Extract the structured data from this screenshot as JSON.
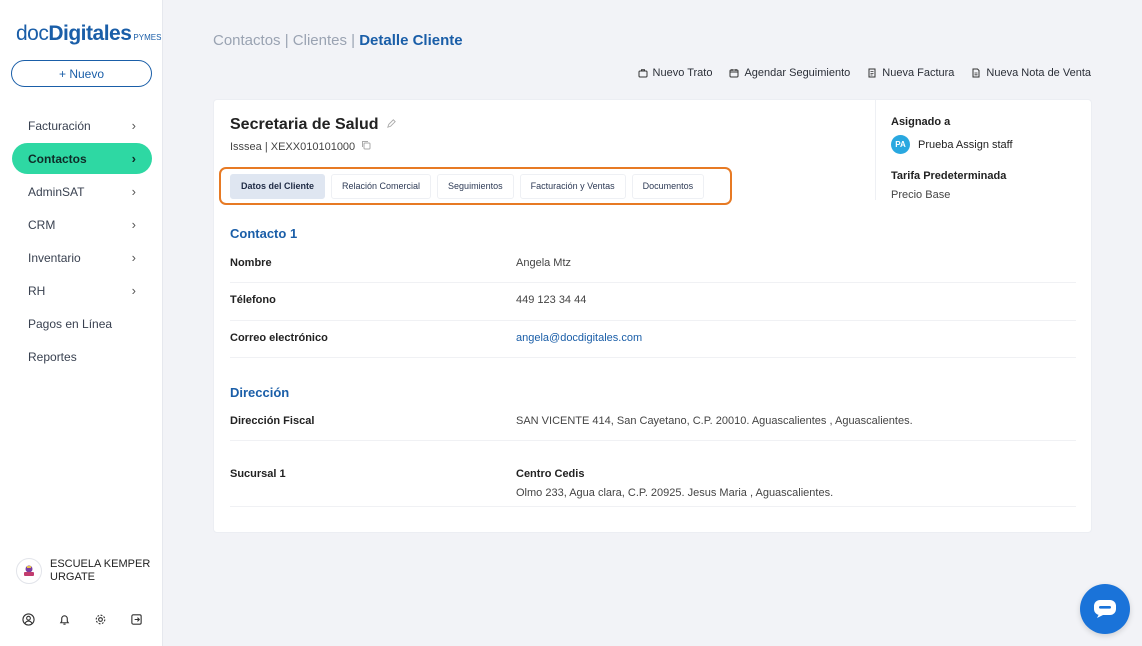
{
  "brand": {
    "doc": "doc",
    "digitales": "Digitales",
    "pymes": "PYMES"
  },
  "new_button": "+ Nuevo",
  "nav": [
    {
      "label": "Facturación",
      "has_children": true,
      "active": false
    },
    {
      "label": "Contactos",
      "has_children": true,
      "active": true
    },
    {
      "label": "AdminSAT",
      "has_children": true,
      "active": false
    },
    {
      "label": "CRM",
      "has_children": true,
      "active": false
    },
    {
      "label": "Inventario",
      "has_children": true,
      "active": false
    },
    {
      "label": "RH",
      "has_children": true,
      "active": false
    },
    {
      "label": "Pagos en Línea",
      "has_children": false,
      "active": false
    },
    {
      "label": "Reportes",
      "has_children": false,
      "active": false
    }
  ],
  "organization": {
    "name_line1": "ESCUELA KEMPER",
    "name_line2": "URGATE"
  },
  "breadcrumb": {
    "part1": "Contactos",
    "sep": " | ",
    "part2": "Clientes",
    "current": "Detalle Cliente"
  },
  "actions": [
    {
      "label": "Nuevo Trato",
      "icon": "briefcase-icon"
    },
    {
      "label": "Agendar Seguimiento",
      "icon": "calendar-icon"
    },
    {
      "label": "Nueva Factura",
      "icon": "invoice-icon"
    },
    {
      "label": "Nueva Nota de Venta",
      "icon": "document-icon"
    }
  ],
  "client": {
    "name": "Secretaria de Salud",
    "subtitle": "Isssea | XEXX010101000"
  },
  "tabs": [
    {
      "label": "Datos del Cliente",
      "active": true
    },
    {
      "label": "Relación Comercial",
      "active": false
    },
    {
      "label": "Seguimientos",
      "active": false
    },
    {
      "label": "Facturación y Ventas",
      "active": false
    },
    {
      "label": "Documentos",
      "active": false
    }
  ],
  "assigned": {
    "label": "Asignado a",
    "initials": "PA",
    "name": "Prueba Assign staff",
    "tariff_label": "Tarifa Predeterminada",
    "tariff_value": "Precio Base"
  },
  "contact": {
    "title": "Contacto 1",
    "name_label": "Nombre",
    "name_value": "Angela Mtz",
    "phone_label": "Télefono",
    "phone_value": "449 123 34 44",
    "email_label": "Correo electrónico",
    "email_value": "angela@docdigitales.com"
  },
  "address": {
    "title": "Dirección",
    "fiscal_label": "Dirección Fiscal",
    "fiscal_value": "SAN VICENTE 414, San Cayetano, C.P. 20010. Aguascalientes , Aguascalientes.",
    "branch_label": "Sucursal 1",
    "branch_name": "Centro Cedis",
    "branch_value": "Olmo 233, Agua clara, C.P. 20925. Jesus Maria , Aguascalientes."
  },
  "colors": {
    "accent": "#1a5ea8",
    "active_nav": "#2ed8a3",
    "tab_highlight": "#e77a24",
    "chat": "#1a73d9"
  }
}
